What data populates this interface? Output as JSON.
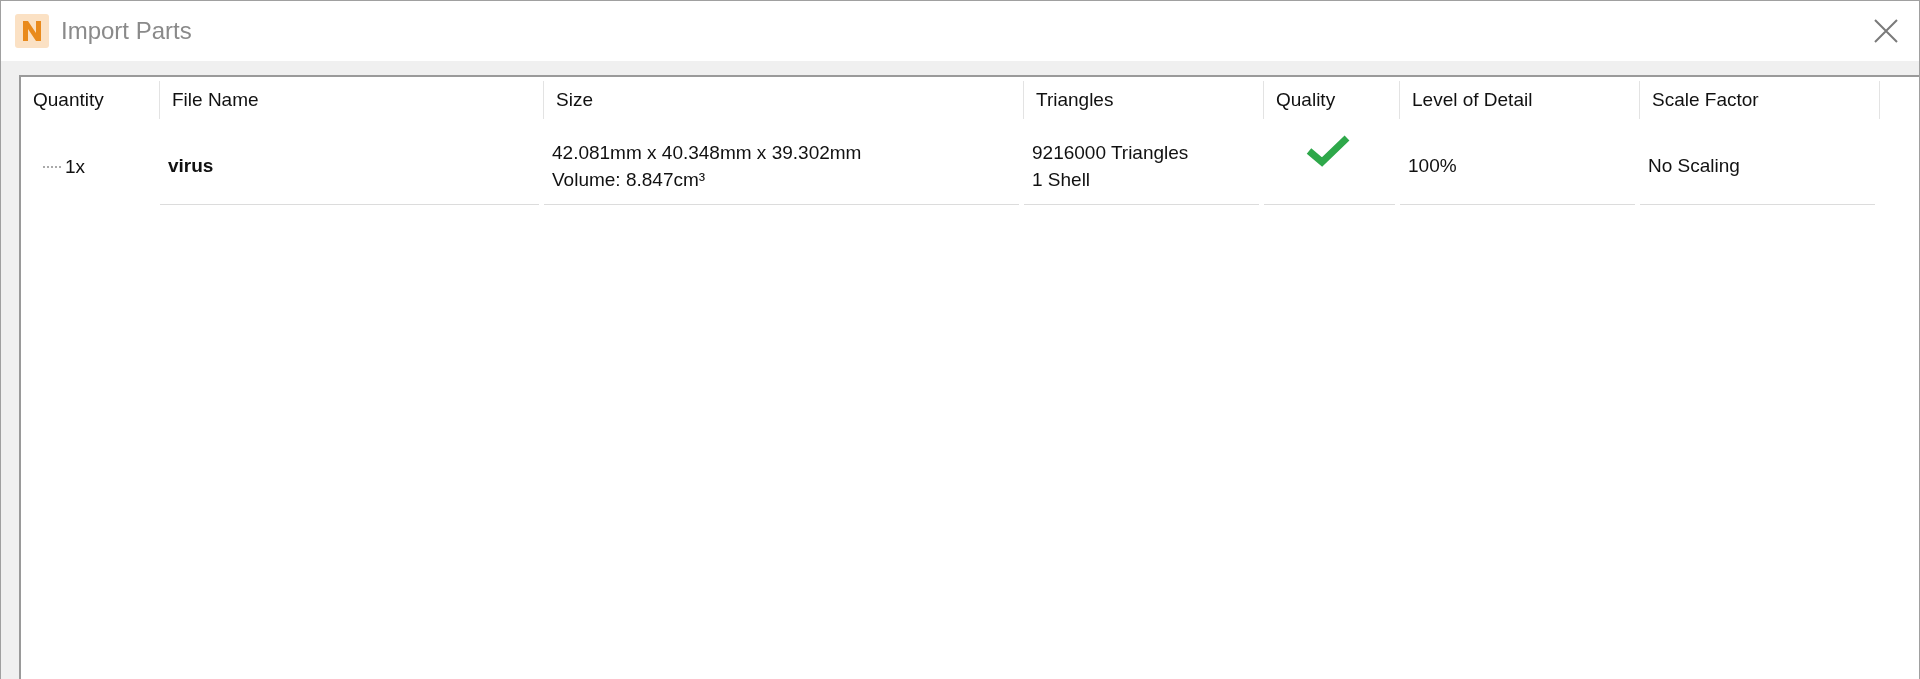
{
  "window": {
    "title": "Import Parts"
  },
  "table": {
    "columns": [
      "Quantity",
      "File Name",
      "Size",
      "Triangles",
      "Quality",
      "Level of Detail",
      "Scale Factor"
    ],
    "rows": [
      {
        "quantity": "1x",
        "file_name": "virus",
        "size": [
          "42.081mm x 40.348mm x 39.302mm",
          "Volume: 8.847cm³"
        ],
        "triangles": [
          "9216000 Triangles",
          "1 Shell"
        ],
        "quality_ok": true,
        "level_of_detail": "100%",
        "scale_factor": "No Scaling"
      }
    ]
  }
}
